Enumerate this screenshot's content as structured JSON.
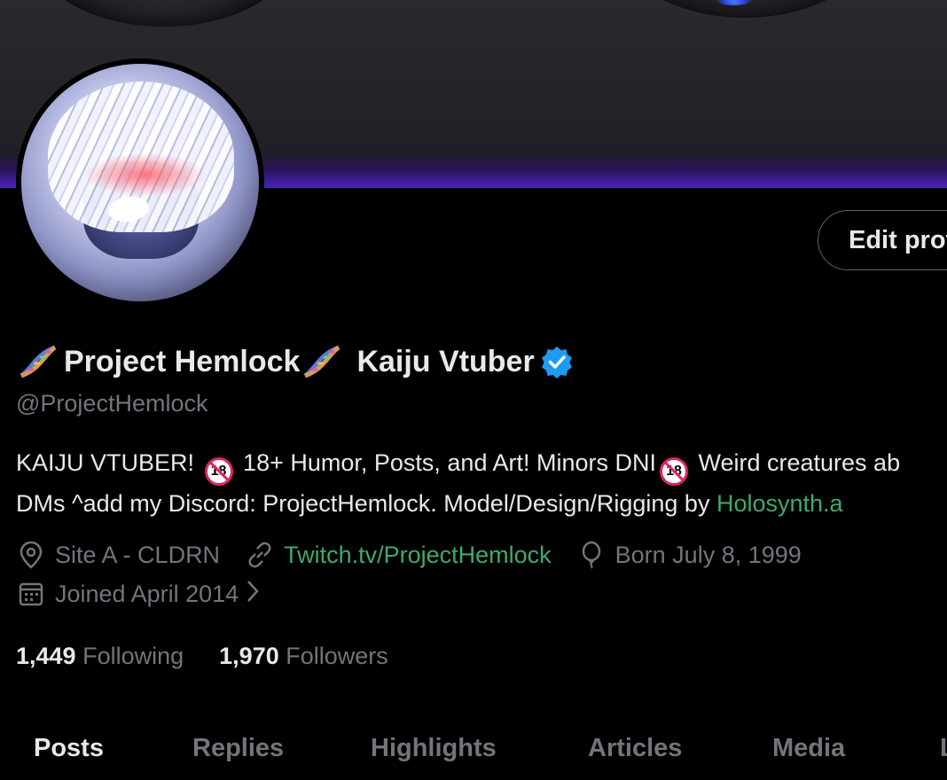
{
  "profile": {
    "display_name_part1": "Project Hemlock",
    "display_name_part2": "Kaiju Vtuber",
    "handle": "@ProjectHemlock",
    "edit_button_label": "Edit profile",
    "bio": {
      "line1_a": "KAIJU VTUBER! ",
      "badge": "18",
      "line1_b": " 18+ Humor, Posts, and Art! Minors DNI",
      "line1_c": " Weird creatures ab",
      "line2_a": "DMs ^add my Discord: ProjectHemlock. Model/Design/Rigging by ",
      "line2_link": "Holosynth.a"
    },
    "location": "Site A - CLDRN",
    "website": "Twitch.tv/ProjectHemlock",
    "birthday": "Born July 8, 1999",
    "joined": "Joined April 2014",
    "following_count": "1,449",
    "following_label": "Following",
    "followers_count": "1,970",
    "followers_label": "Followers"
  },
  "tabs": [
    {
      "label": "Posts",
      "active": true
    },
    {
      "label": "Replies",
      "active": false
    },
    {
      "label": "Highlights",
      "active": false
    },
    {
      "label": "Articles",
      "active": false
    },
    {
      "label": "Media",
      "active": false
    },
    {
      "label": "L",
      "active": false
    }
  ],
  "icons": {
    "name_emoji": "dna-icon",
    "verified": "verified-badge-icon",
    "location": "location-pin-icon",
    "website": "link-icon",
    "birthday": "balloon-icon",
    "joined": "calendar-icon"
  },
  "colors": {
    "background": "#000000",
    "text_primary": "#e7e9ea",
    "text_secondary": "#71767b",
    "link": "#3eaa6c",
    "verified": "#1d9bf0"
  }
}
